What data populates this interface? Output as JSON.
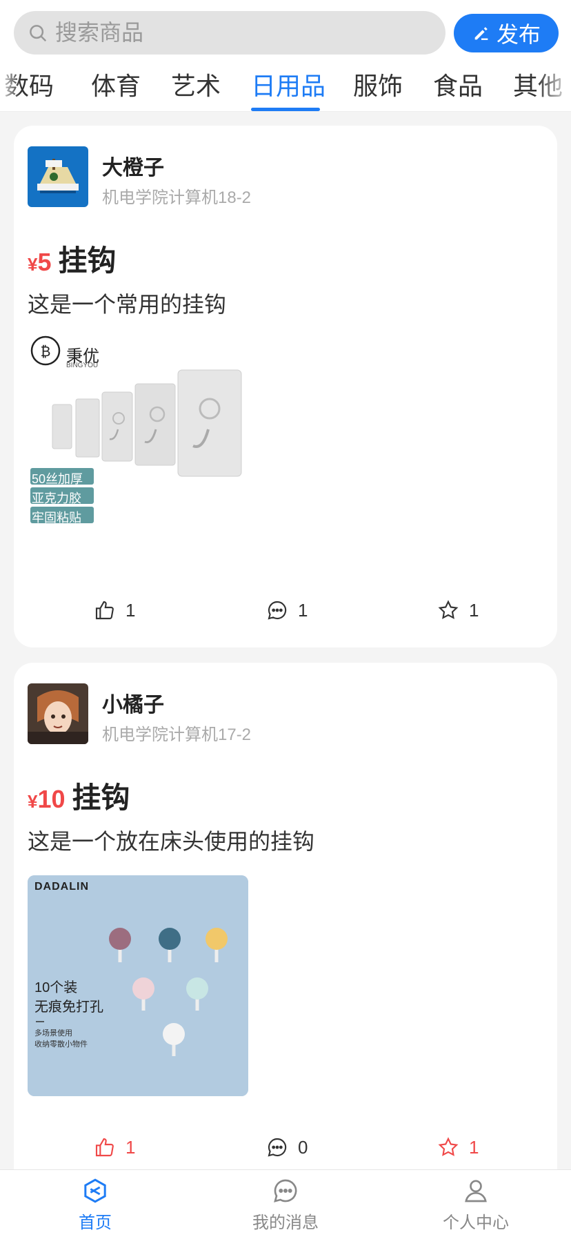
{
  "search": {
    "placeholder": "搜索商品",
    "publish_label": "发布"
  },
  "tabs": [
    {
      "label": "数码"
    },
    {
      "label": "体育"
    },
    {
      "label": "艺术"
    },
    {
      "label": "日用品",
      "active": true
    },
    {
      "label": "服饰"
    },
    {
      "label": "食品"
    },
    {
      "label": "其他"
    }
  ],
  "posts": [
    {
      "user": "大橙子",
      "school": "机电学院计算机18-2",
      "currency": "¥",
      "price": "5",
      "title": "挂钩",
      "description": "这是一个常用的挂钩",
      "image": {
        "brand": "秉优",
        "brand_en": "BINGYOU",
        "badges": [
          "50丝加厚",
          "亚克力胶",
          "牢固粘贴"
        ]
      },
      "likes": "1",
      "comments": "1",
      "favorites": "1"
    },
    {
      "user": "小橘子",
      "school": "机电学院计算机17-2",
      "currency": "¥",
      "price": "10",
      "title": "挂钩",
      "description": "这是一个放在床头使用的挂钩",
      "image": {
        "brand": "DADALIN",
        "line1": "10个装",
        "line2": "无痕免打孔",
        "line3": "多场景使用",
        "line4": "收纳零散小物件"
      },
      "likes": "1",
      "comments": "0",
      "favorites": "1"
    }
  ],
  "nav": [
    {
      "label": "首页",
      "icon": "home-icon"
    },
    {
      "label": "我的消息",
      "icon": "message-icon"
    },
    {
      "label": "个人中心",
      "icon": "person-icon"
    }
  ],
  "colors": {
    "accent": "#1e7cf5",
    "price": "#f04848"
  }
}
